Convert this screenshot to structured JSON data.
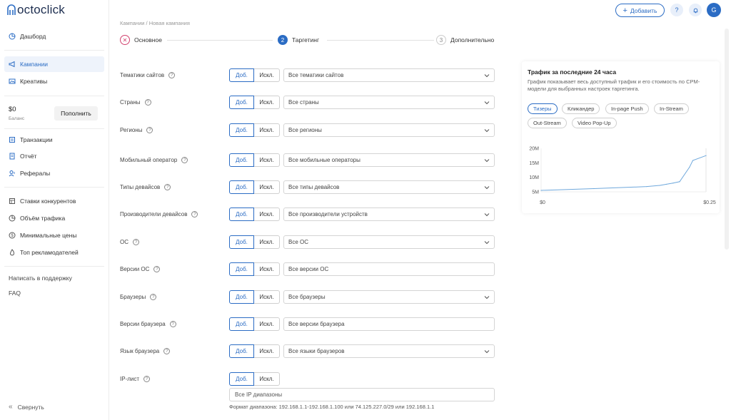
{
  "brand": {
    "name": "octoclick"
  },
  "colors": {
    "accent": "#2b6cc4",
    "error": "#d2416e",
    "chart_line": "#6fa8dc"
  },
  "sidebar": {
    "top_items": [
      {
        "label": "Дашборд",
        "icon": "pie-chart-icon"
      }
    ],
    "main_items": [
      {
        "label": "Кампании",
        "icon": "megaphone-icon",
        "active": true
      },
      {
        "label": "Креативы",
        "icon": "image-icon"
      }
    ],
    "balance": {
      "amount": "$0",
      "label": "Баланс",
      "topup_label": "Пополнить"
    },
    "finance_items": [
      {
        "label": "Транзакции",
        "icon": "transactions-icon"
      },
      {
        "label": "Отчёт",
        "icon": "report-icon"
      },
      {
        "label": "Рефералы",
        "icon": "referrals-icon"
      }
    ],
    "tool_items": [
      {
        "label": "Ставки конкурентов",
        "icon": "table-icon"
      },
      {
        "label": "Объём трафика",
        "icon": "pie-icon"
      },
      {
        "label": "Минимальные цены",
        "icon": "dollar-icon"
      },
      {
        "label": "Топ рекламодателей",
        "icon": "flame-icon"
      }
    ],
    "support_label": "Написать в поддержку",
    "faq_label": "FAQ",
    "collapse_label": "Свернуть"
  },
  "topbar": {
    "add_label": "Добавить",
    "avatar_letter": "G"
  },
  "breadcrumb": "Кампании / Новая кампания",
  "steps": [
    {
      "number": "✕",
      "label": "Основное",
      "state": "error"
    },
    {
      "number": "2",
      "label": "Таргетинг",
      "state": "current"
    },
    {
      "number": "3",
      "label": "Дополнительно",
      "state": "pending"
    }
  ],
  "toggle": {
    "include": "Доб.",
    "exclude": "Искл."
  },
  "rows": [
    {
      "label": "Тематики сайтов",
      "value": "Все тематики сайтов",
      "dropdown": true
    },
    {
      "label": "Страны",
      "value": "Все страны",
      "dropdown": true
    },
    {
      "label": "Регионы",
      "value": "Все регионы",
      "dropdown": true
    },
    {
      "label": "Мобильный оператор",
      "value": "Все мобильные операторы",
      "dropdown": true
    },
    {
      "label": "Типы девайсов",
      "value": "Все типы девайсов",
      "dropdown": true
    },
    {
      "label": "Производители девайсов",
      "value": "Все производители устройств",
      "dropdown": true
    },
    {
      "label": "ОС",
      "value": "Все ОС",
      "dropdown": true
    },
    {
      "label": "Версии ОС",
      "value": "Все версии ОС",
      "dropdown": false
    },
    {
      "label": "Браузеры",
      "value": "Все браузеры",
      "dropdown": true
    },
    {
      "label": "Версии браузера",
      "value": "Все версии браузера",
      "dropdown": false
    },
    {
      "label": "Язык браузера",
      "value": "Все языки браузеров",
      "dropdown": true
    }
  ],
  "ip": {
    "label": "IP-лист",
    "placeholder": "Все IP диапазоны",
    "hint": "Формат диапазона: 192.168.1.1-192.168.1.100 или 74.125.227.0/29 или 192.168.1.1"
  },
  "traffic_panel": {
    "title": "Трафик за последние 24 часа",
    "description": "График показывает весь доступный трафик и его стоимость по CPM-модели для выбранных настроек таргетинга.",
    "chips": [
      {
        "label": "Тизеры",
        "active": true
      },
      {
        "label": "Кликандер",
        "active": false
      },
      {
        "label": "In-page Push",
        "active": false
      },
      {
        "label": "In-Stream",
        "active": false
      },
      {
        "label": "Out-Stream",
        "active": false
      },
      {
        "label": "Video Pop-Up",
        "active": false
      }
    ]
  },
  "chart_data": {
    "type": "line",
    "x_tick_labels": [
      "$0",
      "$0.25"
    ],
    "y_tick_labels": [
      "20M",
      "15M",
      "10M",
      "5M"
    ],
    "ylim": [
      5,
      20
    ],
    "x": [
      0,
      0.08,
      0.16,
      0.18,
      0.19,
      0.2,
      0.21,
      0.225,
      0.23,
      0.25
    ],
    "series": [
      {
        "values": [
          5.5,
          6.1,
          6.8,
          7.2,
          7.6,
          8.0,
          8.5,
          13.5,
          15.8,
          17.5
        ]
      }
    ]
  }
}
